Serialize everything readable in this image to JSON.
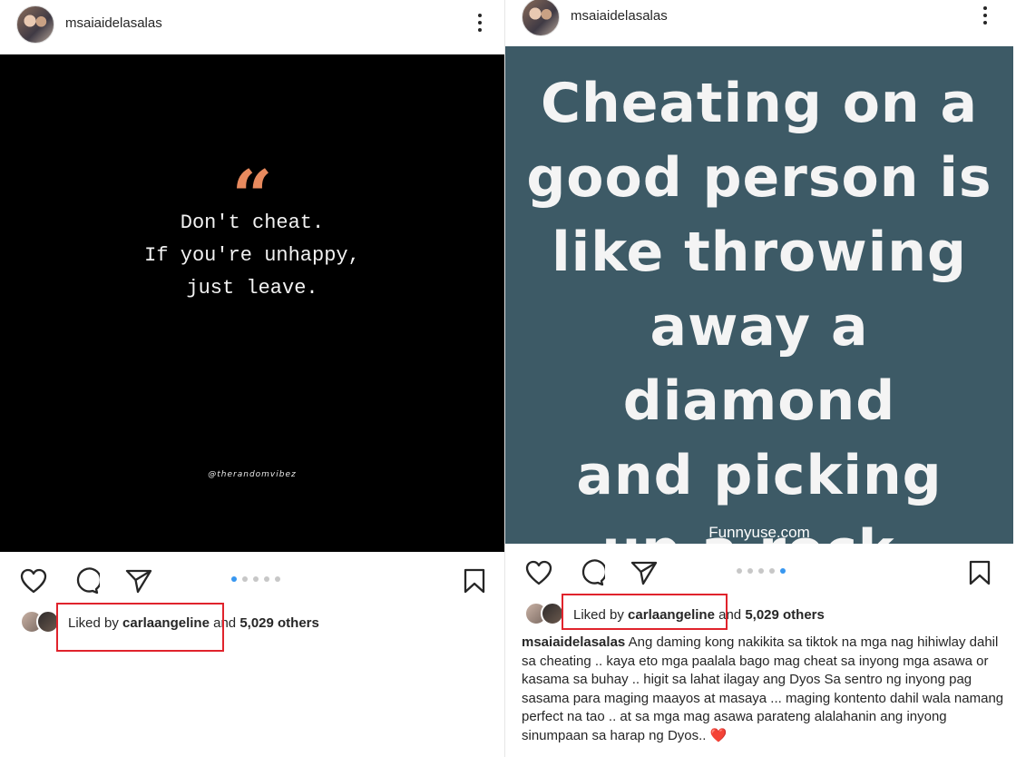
{
  "left_post": {
    "username": "msaiaidelasalas",
    "quote_mark": "“",
    "quote_lines": [
      "Don't cheat.",
      "If you're unhappy,",
      "just leave."
    ],
    "watermark": "@therandomvibez",
    "liked_by_prefix": "Liked by",
    "liked_by_user": "carlaangeline",
    "liked_by_middle": "and",
    "liked_by_count": "5,029 others",
    "carousel_active_index": 0,
    "carousel_count": 5
  },
  "right_post": {
    "username": "msaiaidelasalas",
    "quote_lines": [
      "Cheating on a",
      "good person is",
      "like throwing",
      "away a diamond",
      "and picking",
      "up a rock."
    ],
    "watermark": "Funnyuse.com",
    "liked_by_prefix": "Liked by",
    "liked_by_user": "carlaangeline",
    "liked_by_middle": "and",
    "liked_by_count": "5,029 others",
    "carousel_active_index": 4,
    "carousel_count": 5,
    "caption_username": "msaiaidelasalas",
    "caption_text": "Ang daming kong nakikita sa tiktok na mga nag hihiwlay dahil sa cheating .. kaya eto mga paalala bago mag cheat sa inyong mga asawa or kasama sa buhay .. higit sa lahat ilagay ang Dyos Sa sentro ng inyong pag sasama para maging maayos at masaya ... maging kontento dahil wala namang perfect na tao .. at sa mga mag asawa parateng alalahanin ang inyong sinumpaan sa harap ng Dyos..",
    "caption_emoji": "❤️"
  },
  "colors": {
    "highlight_box": "#e0232c",
    "carousel_active": "#3897f0",
    "quote_accent": "#e88a5e",
    "right_image_bg": "#3d5a66"
  },
  "icons": [
    "heart-icon",
    "comment-icon",
    "share-icon",
    "bookmark-icon",
    "more-options-icon"
  ]
}
